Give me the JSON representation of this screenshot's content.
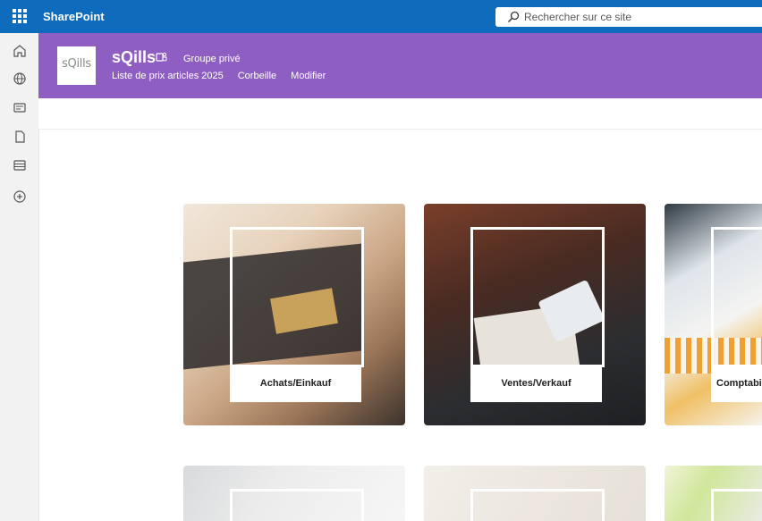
{
  "app": {
    "name": "SharePoint"
  },
  "search": {
    "placeholder": "Rechercher sur ce site"
  },
  "left_rail": {
    "icons": [
      "home-icon",
      "globe-icon",
      "news-icon",
      "document-icon",
      "list-icon",
      "add-icon"
    ]
  },
  "site": {
    "logo_text": "sQills",
    "title": "sQills",
    "group_label": "Groupe privé",
    "nav": [
      "Liste de prix articles 2025",
      "Corbeille",
      "Modifier"
    ]
  },
  "tiles": [
    {
      "label": "Achats/Einkauf"
    },
    {
      "label": "Ventes/Verkauf"
    },
    {
      "label": "Comptabi"
    }
  ],
  "colors": {
    "suite_bar": "#0f6cbd",
    "site_header": "#8f5ec3"
  }
}
